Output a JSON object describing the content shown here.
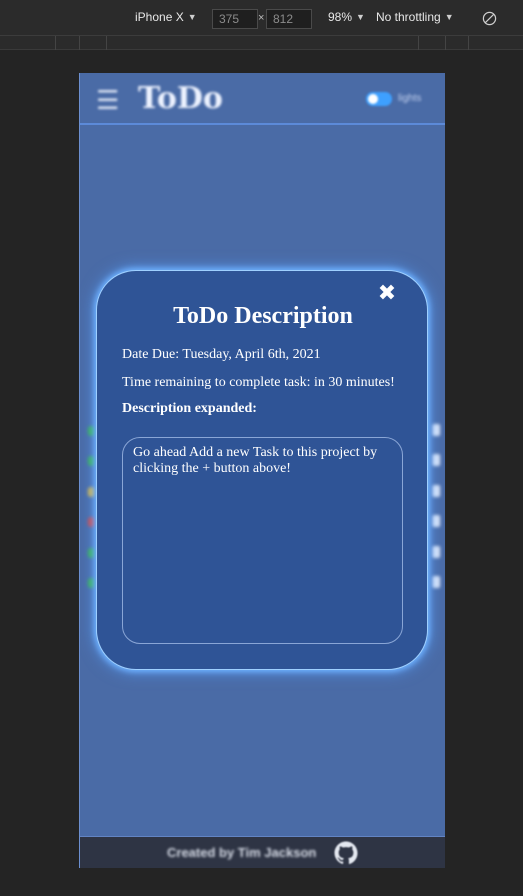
{
  "devtools": {
    "device": "iPhone X",
    "width": "375",
    "height": "812",
    "zoom": "98%",
    "throttling": "No throttling",
    "times_symbol": "×"
  },
  "app": {
    "title": "ToDo",
    "toggle_label": "lights",
    "footer_text": "Created by Tim Jackson",
    "row_dot_colors": [
      "#39b54a",
      "#39b54a",
      "#e0b93c",
      "#d8453f",
      "#39b54a",
      "#39b54a"
    ]
  },
  "modal": {
    "title": "ToDo Description",
    "date_due": "Date Due: Tuesday, April 6th, 2021",
    "time_remaining": "Time remaining to complete task: in 30 minutes!",
    "description_label": "Description expanded:",
    "description_text": "Go ahead Add a new Task to this project by clicking the + button above!",
    "close_symbol": "✖"
  }
}
